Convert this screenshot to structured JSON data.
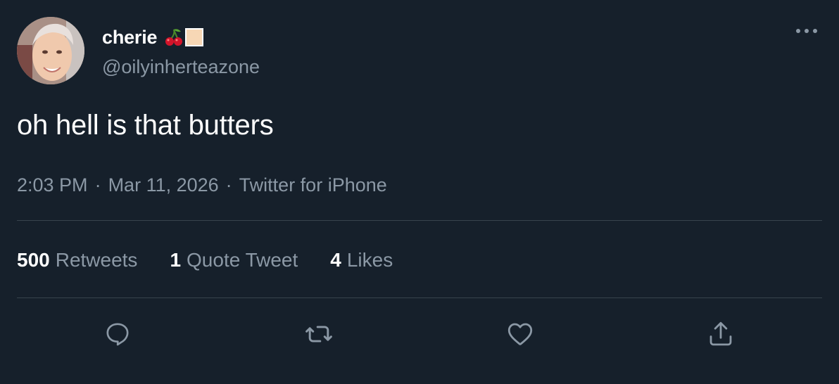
{
  "user": {
    "display_name": "cherie",
    "handle": "@oilyinherteazone"
  },
  "tweet": {
    "text": "oh hell is that butters",
    "time": "2:03 PM",
    "separator": "·",
    "date": "Mar 11, 2026",
    "source": "Twitter for iPhone"
  },
  "stats": [
    {
      "count": "500",
      "label": "Retweets"
    },
    {
      "count": "1",
      "label": "Quote Tweet"
    },
    {
      "count": "4",
      "label": "Likes"
    }
  ],
  "icons": {
    "more": "more-horizontal-icon",
    "reply": "reply-icon",
    "retweet": "retweet-icon",
    "like": "heart-icon",
    "share": "share-icon",
    "emoji1": "cherry-icon",
    "emoji2": "square-swatch-icon"
  },
  "colors": {
    "background": "#16202b",
    "text_primary": "#ffffff",
    "text_secondary": "#8b98a5",
    "divider": "#38444d"
  }
}
